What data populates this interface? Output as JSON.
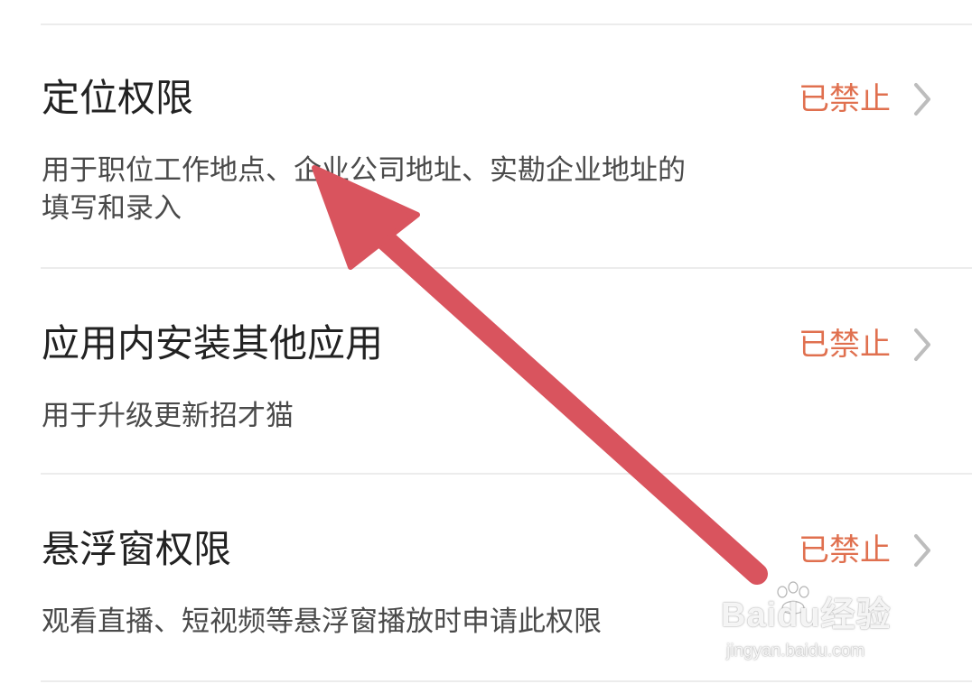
{
  "permissions": [
    {
      "title": "定位权限",
      "description": "用于职位工作地点、企业公司地址、实勘企业地址的填写和录入",
      "status": "已禁止"
    },
    {
      "title": "应用内安装其他应用",
      "description": "用于升级更新招才猫",
      "status": "已禁止"
    },
    {
      "title": "悬浮窗权限",
      "description": "观看直播、短视频等悬浮窗播放时申请此权限",
      "status": "已禁止"
    }
  ],
  "annotation": {
    "arrow_color": "#d9545e"
  },
  "watermark": {
    "brand": "Baidu经验",
    "domain": "jingyan.baidu.com"
  },
  "colors": {
    "status": "#e0704f",
    "title": "#222222",
    "description": "#4a4a4a",
    "divider": "#ececec",
    "chevron": "#bdbdbd"
  },
  "icons": {
    "row_chevron": "chevron-right-icon",
    "watermark_logo": "paw-icon"
  }
}
